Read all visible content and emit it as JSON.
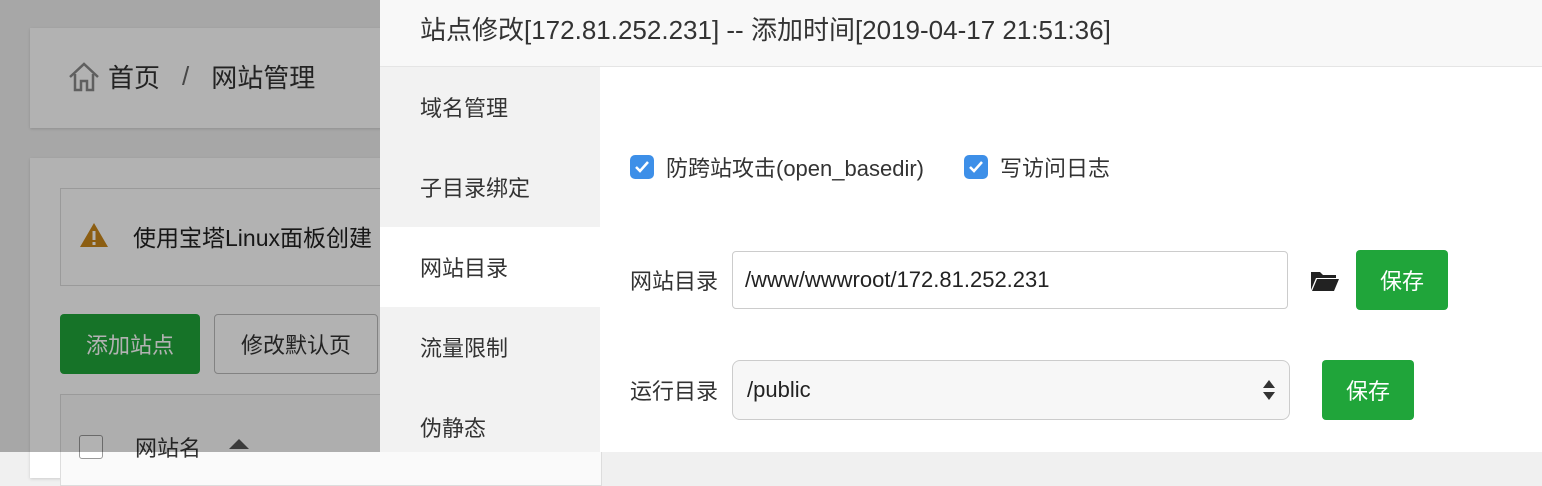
{
  "background": {
    "breadcrumb": {
      "home": "首页",
      "separator": "/",
      "current": "网站管理"
    },
    "alert_text": "使用宝塔Linux面板创建",
    "add_site_button": "添加站点",
    "modify_default_button": "修改默认页",
    "table_header_site_name": "网站名"
  },
  "modal": {
    "title": "站点修改[172.81.252.231] -- 添加时间[2019-04-17 21:51:36]",
    "nav": [
      {
        "label": "域名管理"
      },
      {
        "label": "子目录绑定"
      },
      {
        "label": "网站目录"
      },
      {
        "label": "流量限制"
      },
      {
        "label": "伪静态"
      }
    ],
    "active_nav": "网站目录",
    "options": {
      "anti_xss": {
        "label": "防跨站攻击(open_basedir)",
        "checked": true
      },
      "access_log": {
        "label": "写访问日志",
        "checked": true
      }
    },
    "site_dir": {
      "label": "网站目录",
      "value": "/www/wwwroot/172.81.252.231",
      "save": "保存"
    },
    "run_dir": {
      "label": "运行目录",
      "value": "/public",
      "save": "保存"
    }
  },
  "colors": {
    "primary_green": "#20a53a",
    "checkbox_blue": "#3d8fe8"
  }
}
